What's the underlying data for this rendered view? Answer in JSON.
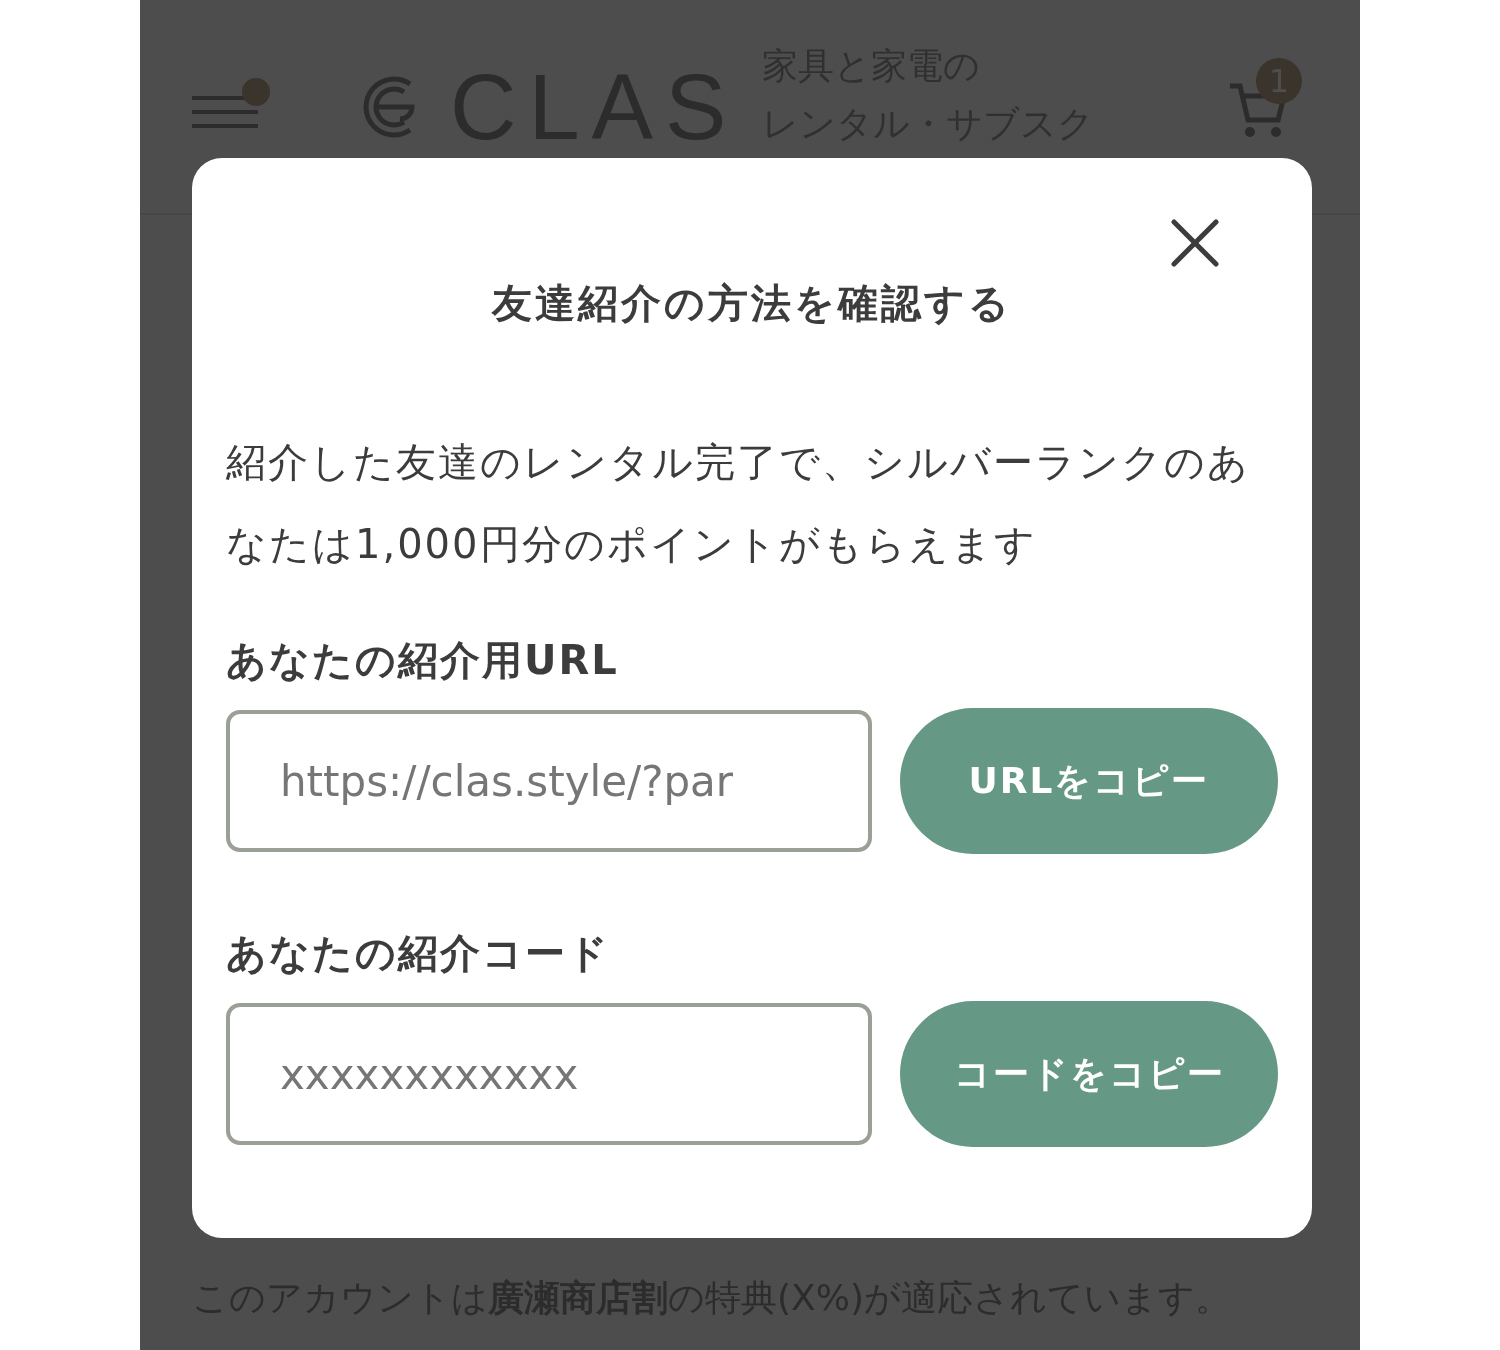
{
  "header": {
    "logo": "CLAS",
    "tagline": [
      "家具と家電の",
      "レンタル・サブスク"
    ],
    "cart_count": "1"
  },
  "notice": "このアカウントは**廣瀬商店割**の特典(X%)が適応されています。",
  "modal": {
    "title": "友達紹介の方法を確認する",
    "description": "紹介した友達のレンタル完了で、シルバーランクのあなたは1,000円分のポイントがもらえます",
    "fields": [
      {
        "label": "あなたの紹介用URL",
        "value": "https://clas.style/?par",
        "button": "URLをコピー"
      },
      {
        "label": "あなたの紹介コード",
        "value": "xxxxxxxxxxxx",
        "button": "コードをコピー"
      }
    ]
  }
}
